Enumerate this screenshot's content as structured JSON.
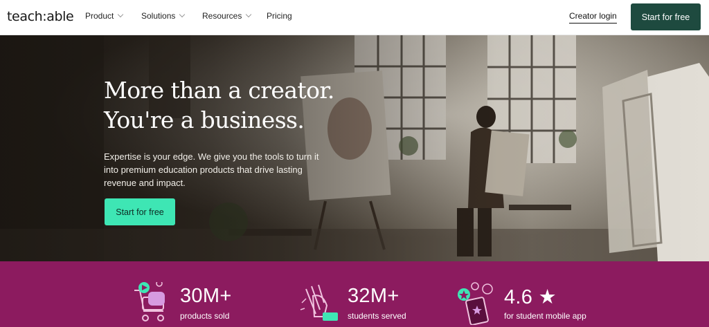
{
  "brand": {
    "logo": "teach:able"
  },
  "nav": {
    "items": [
      {
        "label": "Product",
        "has_dropdown": true
      },
      {
        "label": "Solutions",
        "has_dropdown": true
      },
      {
        "label": "Resources",
        "has_dropdown": true
      },
      {
        "label": "Pricing",
        "has_dropdown": false
      }
    ],
    "login_label": "Creator login",
    "cta_label": "Start for free"
  },
  "hero": {
    "headline_line1": "More than a creator.",
    "headline_line2": "You're a business.",
    "subtext": "Expertise is your edge. We give you the tools to turn it into premium education products that drive lasting revenue and impact.",
    "cta_label": "Start for free",
    "background": "photo of an artist painting in a sunlit studio"
  },
  "stats": [
    {
      "value": "30M+",
      "label": "products sold",
      "icon": "shopping-cart-icon"
    },
    {
      "value": "32M+",
      "label": "students served",
      "icon": "clapping-hands-icon"
    },
    {
      "value": "4.6 ★",
      "label": "for student mobile app",
      "icon": "mobile-app-icon"
    }
  ],
  "colors": {
    "nav_cta": "#1e4a3f",
    "hero_cta": "#3ee6b4",
    "stats_band": "#8c1b5f"
  }
}
